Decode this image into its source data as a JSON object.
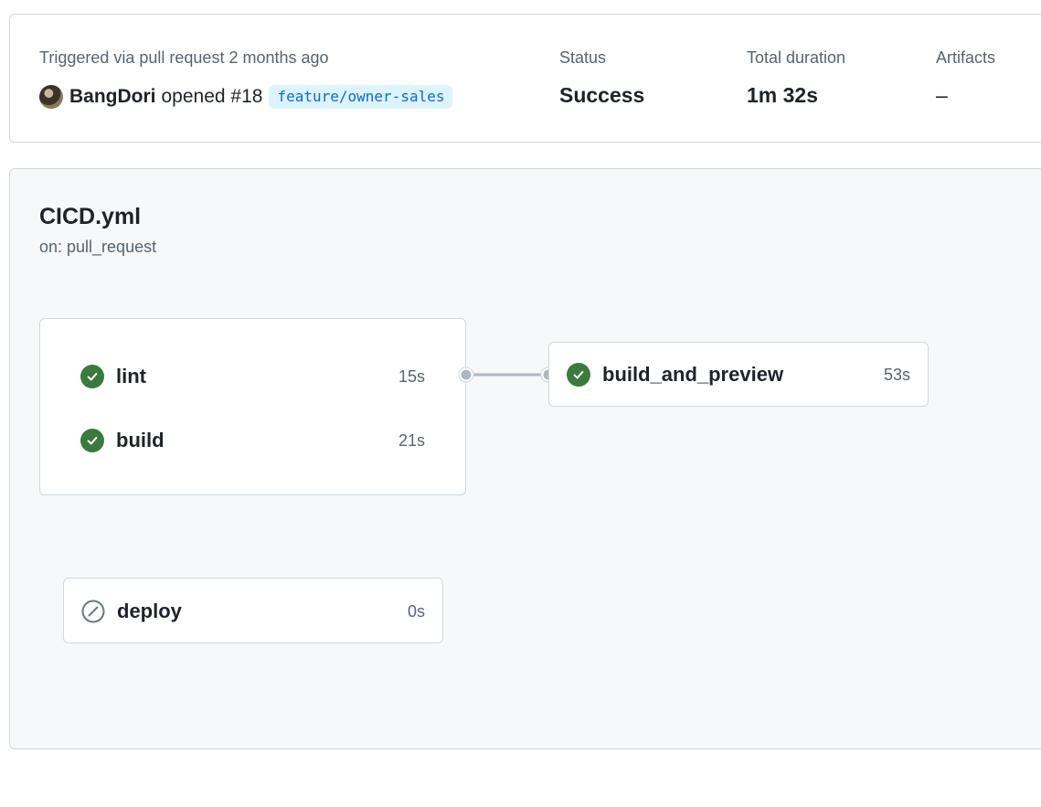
{
  "summary": {
    "trigger_text": "Triggered via pull request 2 months ago",
    "actor": "BangDori",
    "action": "opened #18",
    "branch": "feature/owner-sales",
    "status_label": "Status",
    "status_value": "Success",
    "duration_label": "Total duration",
    "duration_value": "1m 32s",
    "artifacts_label": "Artifacts",
    "artifacts_value": "–"
  },
  "workflow": {
    "file": "CICD.yml",
    "trigger": "on: pull_request",
    "groups": [
      {
        "jobs": [
          {
            "name": "lint",
            "duration": "15s",
            "status": "success"
          },
          {
            "name": "build",
            "duration": "21s",
            "status": "success"
          }
        ]
      }
    ],
    "downstream_job": {
      "name": "build_and_preview",
      "duration": "53s",
      "status": "success"
    },
    "deploy_job": {
      "name": "deploy",
      "duration": "0s",
      "status": "skipped"
    }
  },
  "colors": {
    "success": "#3a7a3f",
    "skipped": "#6e7781",
    "branch_text": "#0969da",
    "branch_bg": "#ddf4ff",
    "connector": "#afb8c1"
  }
}
